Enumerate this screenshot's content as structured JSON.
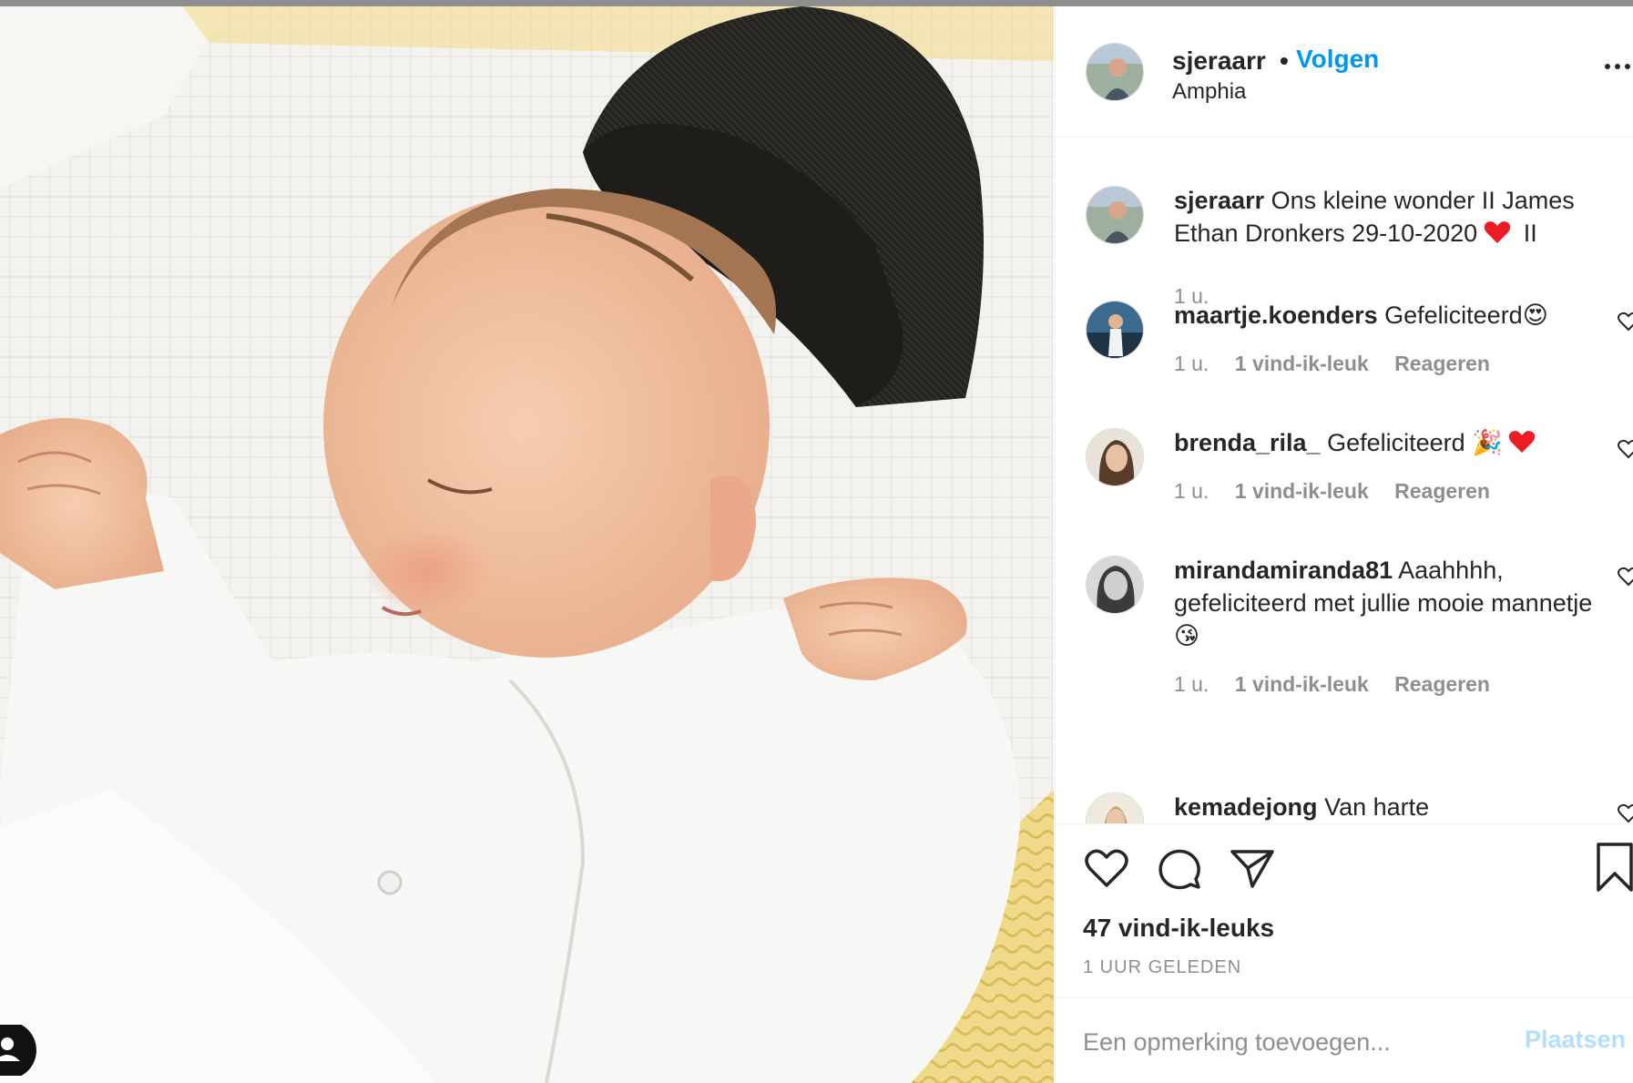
{
  "post": {
    "username": "sjeraarr",
    "follow_label": "Volgen",
    "separator": "•",
    "location": "Amphia"
  },
  "caption": {
    "username": "sjeraarr",
    "text": "Ons kleine wonder II James Ethan Dronkers 29-10-2020",
    "suffix": "II",
    "time": "1 u."
  },
  "comments": [
    {
      "username": "maartje.koenders",
      "text": "Gefeliciteerd😍",
      "time": "1 u.",
      "likes": "1 vind-ik-leuk",
      "reply": "Reageren"
    },
    {
      "username": "brenda_rila_",
      "text": "Gefeliciteerd 🎉",
      "time": "1 u.",
      "likes": "1 vind-ik-leuk",
      "reply": "Reageren"
    },
    {
      "username": "mirandamiranda81",
      "text": "Aaahhhh, gefeliciteerd met jullie mooie mannetje😘",
      "time": "1 u.",
      "likes": "1 vind-ik-leuk",
      "reply": "Reageren"
    },
    {
      "username": "kemadejong",
      "text": "Van harte"
    }
  ],
  "likes_count": "47 vind-ik-leuks",
  "time_ago": "1 UUR GELEDEN",
  "comment_input": {
    "placeholder": "Een opmerking toevoegen...",
    "value": ""
  },
  "post_button": "Plaatsen",
  "icons": [
    "heart-icon",
    "comment-icon",
    "share-icon",
    "bookmark-icon",
    "more-icon",
    "user-tag-icon"
  ],
  "colors": {
    "link": "#0095f6",
    "muted": "#8e8e8e",
    "text": "#262626",
    "post_disabled": "#b2dffc",
    "red_heart": "#ed1c24"
  }
}
